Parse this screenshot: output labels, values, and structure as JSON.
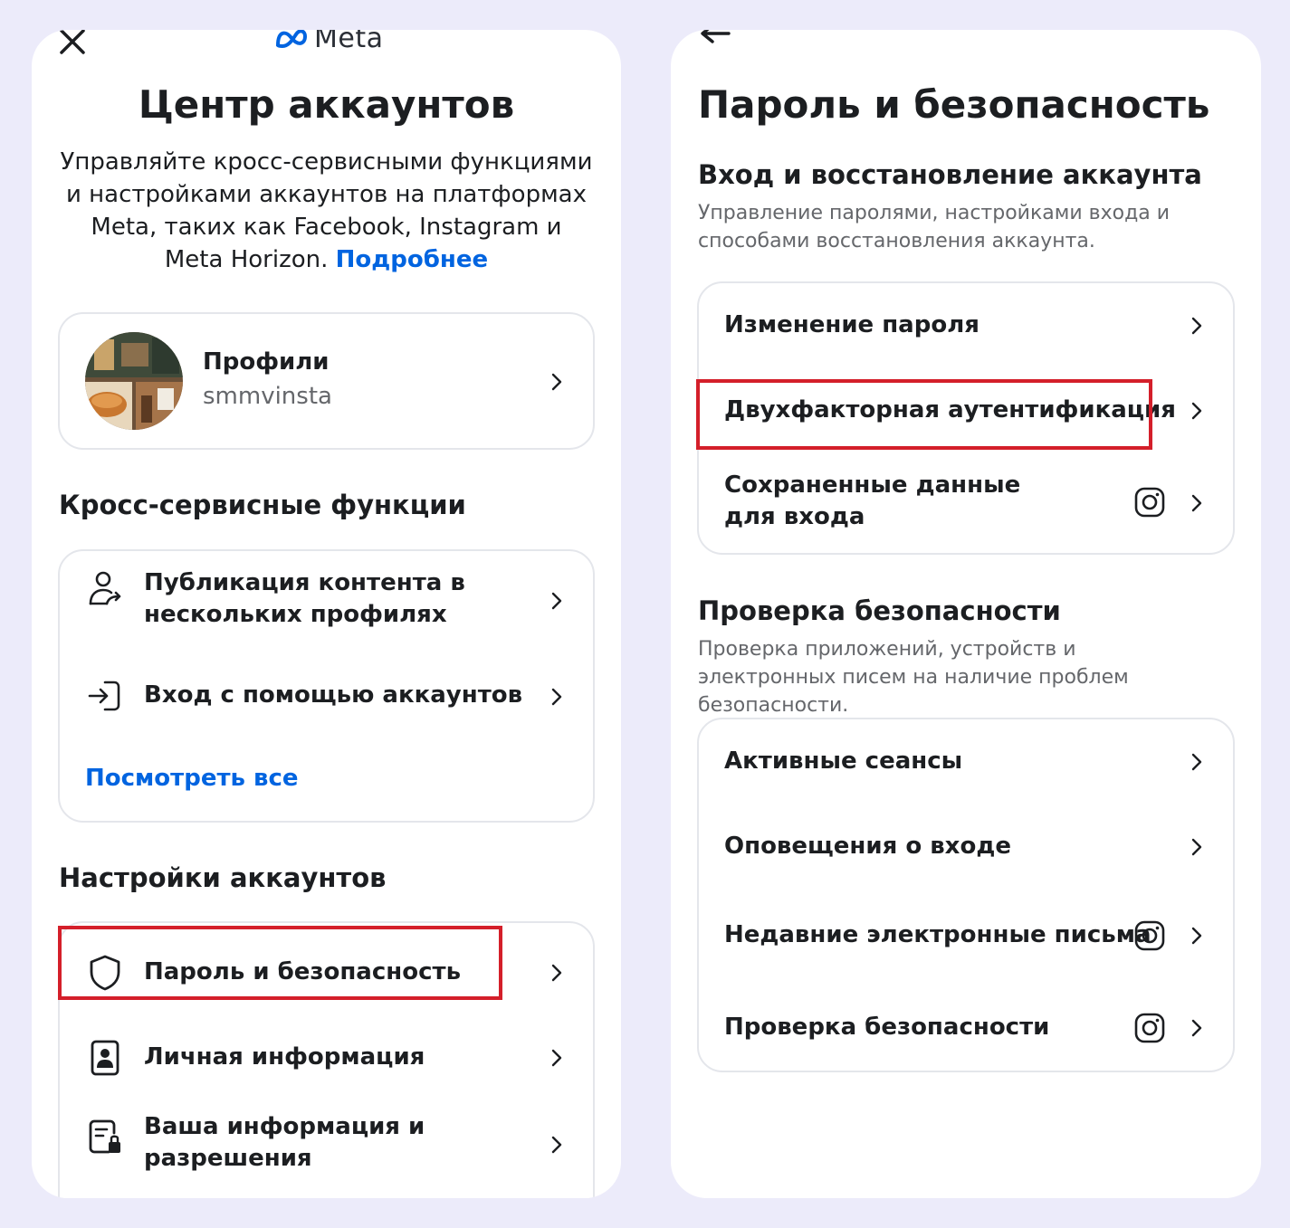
{
  "left": {
    "brand": "Meta",
    "title": "Центр аккаунтов",
    "description": "Управляйте кросс-сервисными функциями и настройками аккаунтов на платформах Meta, таких как Facebook, Instagram и Meta Horizon.",
    "learn_more": "Подробнее",
    "profiles": {
      "label": "Профили",
      "username": "smmvinsta"
    },
    "cross_section_title": "Кросс-сервисные функции",
    "cross_items": [
      {
        "label": "Публикация контента в нескольких профилях",
        "icon": "person-share-icon"
      },
      {
        "label": "Вход с помощью аккаунтов",
        "icon": "login-arrow-icon"
      }
    ],
    "see_all": "Посмотреть все",
    "settings_section_title": "Настройки аккаунтов",
    "settings_items": [
      {
        "label": "Пароль и безопасность",
        "icon": "shield-icon",
        "highlighted": true
      },
      {
        "label": "Личная информация",
        "icon": "id-card-icon"
      },
      {
        "label": "Ваша информация и разрешения",
        "icon": "document-lock-icon"
      }
    ]
  },
  "right": {
    "title": "Пароль и безопасность",
    "login_section": {
      "title": "Вход и восстановление аккаунта",
      "description": "Управление паролями, настройками входа и способами восстановления аккаунта.",
      "items": [
        {
          "label": "Изменение пароля",
          "instagram": false
        },
        {
          "label": "Двухфакторная аутентификация",
          "instagram": false,
          "highlighted": true
        },
        {
          "label": "Сохраненные данные для входа",
          "instagram": true
        }
      ]
    },
    "security_section": {
      "title": "Проверка безопасности",
      "description": "Проверка приложений, устройств и электронных писем на наличие проблем безопасности.",
      "items": [
        {
          "label": "Активные сеансы",
          "instagram": false
        },
        {
          "label": "Оповещения о входе",
          "instagram": false
        },
        {
          "label": "Недавние электронные письма",
          "instagram": true
        },
        {
          "label": "Проверка безопасности",
          "instagram": true
        }
      ]
    }
  },
  "colors": {
    "background": "#ecebfa",
    "link": "#0064e0",
    "highlight": "#d41f2a",
    "muted": "#65676b"
  }
}
